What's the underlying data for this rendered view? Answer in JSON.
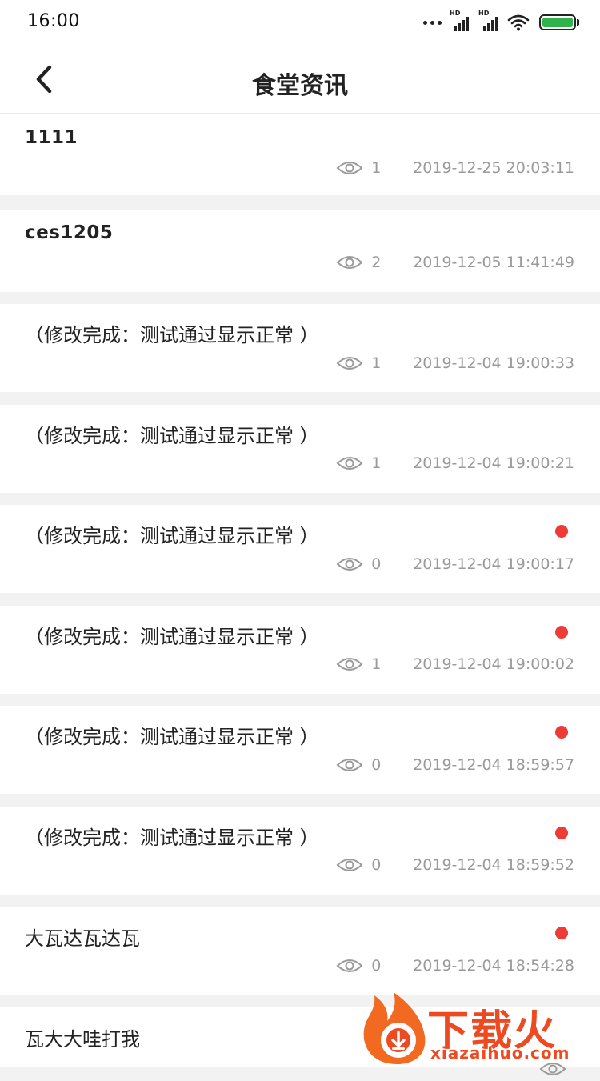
{
  "status_bar": {
    "time": "16:00",
    "hd_label": "HD",
    "battery_color": "#2fb34a"
  },
  "nav": {
    "title": "食堂资讯",
    "back_icon": "chevron-left-icon"
  },
  "colors": {
    "unread_dot": "#ef3b36",
    "meta_text": "#9a9a9a",
    "watermark": "#ee4a22"
  },
  "news": [
    {
      "title": "1111",
      "views": "1",
      "date": "2019-12-25 20:03:11",
      "unread": false
    },
    {
      "title": "ces1205",
      "views": "2",
      "date": "2019-12-05 11:41:49",
      "unread": false
    },
    {
      "title": "（修改完成：测试通过显示正常 ）",
      "views": "1",
      "date": "2019-12-04 19:00:33",
      "unread": false
    },
    {
      "title": "（修改完成：测试通过显示正常 ）",
      "views": "1",
      "date": "2019-12-04 19:00:21",
      "unread": false
    },
    {
      "title": "（修改完成：测试通过显示正常 ）",
      "views": "0",
      "date": "2019-12-04 19:00:17",
      "unread": true
    },
    {
      "title": "（修改完成：测试通过显示正常 ）",
      "views": "1",
      "date": "2019-12-04 19:00:02",
      "unread": true
    },
    {
      "title": "（修改完成：测试通过显示正常 ）",
      "views": "0",
      "date": "2019-12-04 18:59:57",
      "unread": true
    },
    {
      "title": "（修改完成：测试通过显示正常 ）",
      "views": "0",
      "date": "2019-12-04 18:59:52",
      "unread": true
    },
    {
      "title": "大瓦达瓦达瓦",
      "views": "0",
      "date": "2019-12-04 18:54:28",
      "unread": true
    },
    {
      "title": "瓦大大哇打我",
      "views": "",
      "date": "",
      "unread": false
    }
  ],
  "watermark": {
    "brand": "下载火",
    "url": "xiazaihuo.com"
  }
}
